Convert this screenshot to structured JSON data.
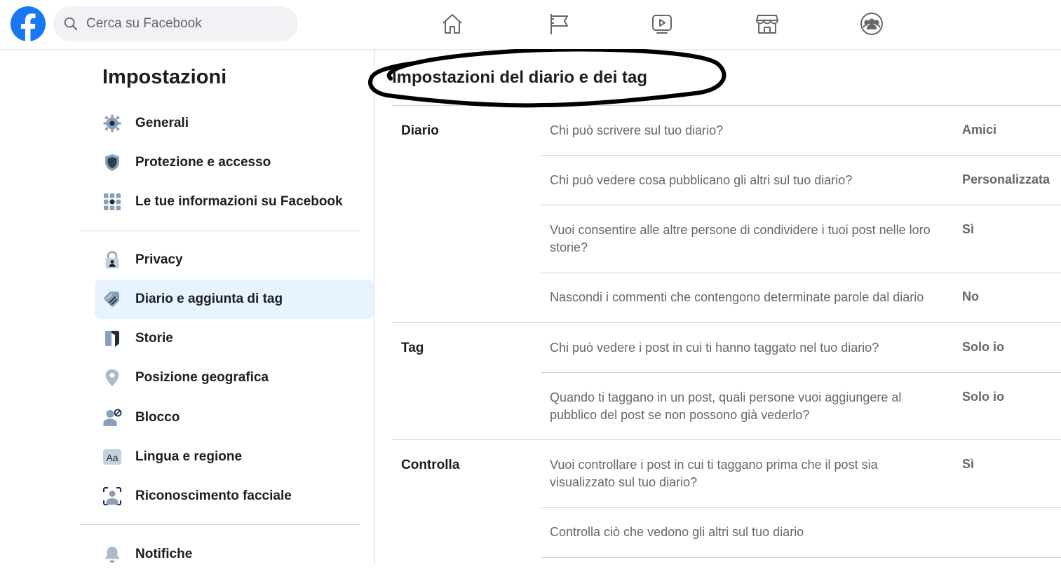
{
  "topbar": {
    "search_placeholder": "Cerca su Facebook",
    "nav": [
      "home-icon",
      "pages-flag-icon",
      "watch-video-icon",
      "marketplace-icon",
      "groups-icon"
    ],
    "brand_color": "#1877f2"
  },
  "sidebar": {
    "title": "Impostazioni",
    "group1": [
      {
        "label": "Generali",
        "icon": "gear-icon"
      },
      {
        "label": "Protezione e accesso",
        "icon": "shield-icon"
      },
      {
        "label": "Le tue informazioni su Facebook",
        "icon": "grid-icon"
      }
    ],
    "group2": [
      {
        "label": "Privacy",
        "icon": "lock-icon"
      },
      {
        "label": "Diario e aggiunta di tag",
        "icon": "tag-icon",
        "active": true
      },
      {
        "label": "Storie",
        "icon": "book-icon"
      },
      {
        "label": "Posizione geografica",
        "icon": "location-pin-icon"
      },
      {
        "label": "Blocco",
        "icon": "block-user-icon"
      },
      {
        "label": "Lingua e regione",
        "icon": "language-icon"
      },
      {
        "label": "Riconoscimento facciale",
        "icon": "face-recognition-icon"
      }
    ],
    "group3": [
      {
        "label": "Notifiche",
        "icon": "bell-icon"
      }
    ],
    "active_bg": "#e7f3ff"
  },
  "main": {
    "title": "Impostazioni del diario e dei tag",
    "sections": [
      {
        "title": "Diario",
        "rows": [
          {
            "question": "Chi può scrivere sul tuo diario?",
            "value": "Amici"
          },
          {
            "question": "Chi può vedere cosa pubblicano gli altri sul tuo diario?",
            "value": "Personalizzata"
          },
          {
            "question": "Vuoi consentire alle altre persone di condividere i tuoi post nelle loro storie?",
            "value": "Sì"
          },
          {
            "question": "Nascondi i commenti che contengono determinate parole dal diario",
            "value": "No"
          }
        ]
      },
      {
        "title": "Tag",
        "rows": [
          {
            "question": "Chi può vedere i post in cui ti hanno taggato nel tuo diario?",
            "value": "Solo io"
          },
          {
            "question": "Quando ti taggano in un post, quali persone vuoi aggiungere al pubblico del post se non possono già vederlo?",
            "value": "Solo io"
          }
        ]
      },
      {
        "title": "Controlla",
        "rows": [
          {
            "question": "Vuoi controllare i post in cui ti taggano prima che il post sia visualizzato sul tuo diario?",
            "value": "Sì"
          },
          {
            "question": "Controlla ciò che vedono gli altri sul tuo diario",
            "value": ""
          }
        ]
      }
    ]
  }
}
